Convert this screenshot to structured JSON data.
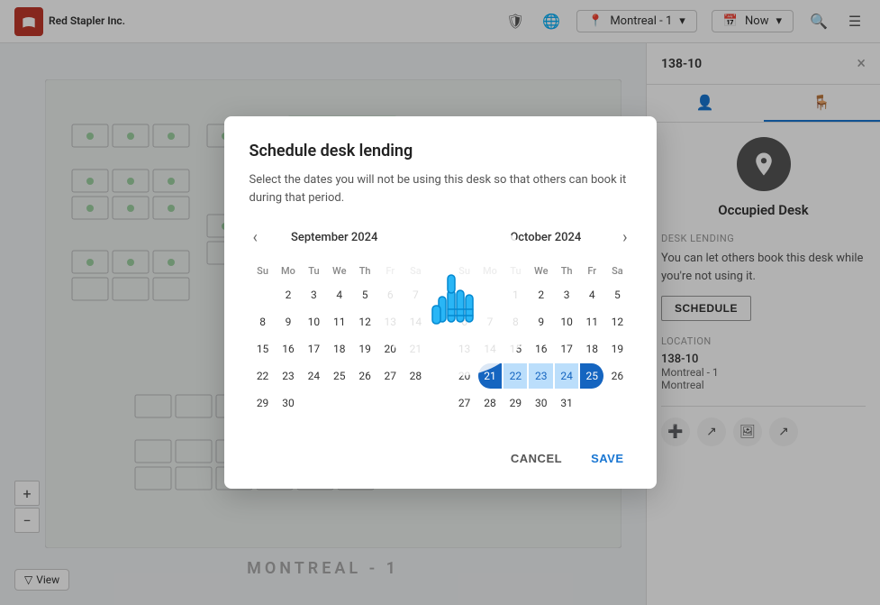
{
  "app": {
    "company": "Red Stapler\nInc.",
    "location": "Montreal - 1",
    "time": "Now"
  },
  "panel": {
    "title": "138-10",
    "close_label": "×",
    "tabs": [
      {
        "id": "person",
        "label": "👤",
        "active": false
      },
      {
        "id": "desk",
        "label": "🪑",
        "active": true
      }
    ],
    "desk_status": "Occupied Desk",
    "lending_section": "Desk Lending",
    "lending_text": "You can let others book this desk while you're not using it.",
    "schedule_label": "SCHEDULE",
    "location_section": "Location",
    "location_line1": "138-10",
    "location_line2": "Montreal - 1",
    "location_line3": "Montreal"
  },
  "modal": {
    "title": "Schedule desk lending",
    "description": "Select the dates you will not be using this desk so that others can book it during that period.",
    "cal_sep": {
      "month": "September",
      "year": "2024",
      "days_header": [
        "Su",
        "Mo",
        "Tu",
        "We",
        "Th",
        "Fr",
        "Sa"
      ],
      "weeks": [
        [
          "",
          "2",
          "3",
          "4",
          "5",
          "6",
          "7"
        ],
        [
          "8",
          "9",
          "10",
          "11",
          "12",
          "13",
          "14"
        ],
        [
          "15",
          "16",
          "17",
          "18",
          "19",
          "20",
          "21"
        ],
        [
          "22",
          "23",
          "24",
          "25",
          "26",
          "27",
          "28"
        ],
        [
          "29",
          "30",
          "",
          "",
          "",
          "",
          ""
        ]
      ]
    },
    "cal_oct": {
      "month": "October",
      "year": "2024",
      "days_header": [
        "Su",
        "Mo",
        "Tu",
        "We",
        "Th",
        "Fr",
        "Sa"
      ],
      "weeks": [
        [
          "",
          "",
          "1",
          "2",
          "3",
          "4",
          "5"
        ],
        [
          "6",
          "7",
          "8",
          "9",
          "10",
          "11",
          "12"
        ],
        [
          "13",
          "14",
          "15",
          "16",
          "17",
          "18",
          "19"
        ],
        [
          "20",
          "21",
          "22",
          "23",
          "24",
          "25",
          "26"
        ],
        [
          "27",
          "28",
          "29",
          "30",
          "31",
          "",
          ""
        ]
      ],
      "selected_range": [
        21,
        22,
        23,
        24,
        25
      ]
    },
    "cancel_label": "CANCEL",
    "save_label": "SAVE"
  },
  "floor": {
    "label": "MONTREAL - 1"
  },
  "zoom": {
    "plus": "+",
    "minus": "−",
    "view": "View"
  }
}
